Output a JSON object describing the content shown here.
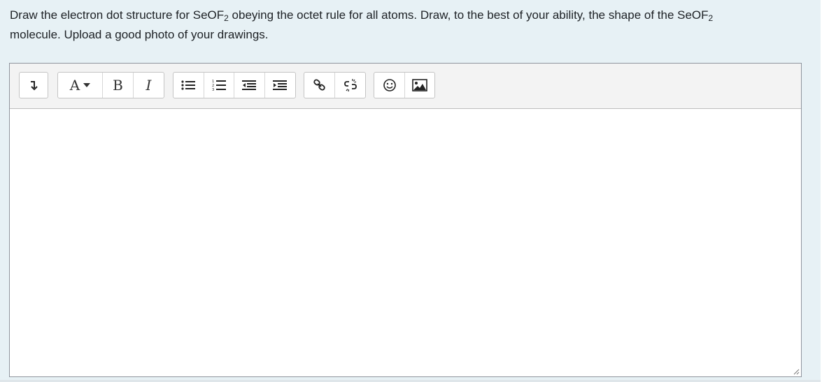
{
  "question": {
    "text_part1": "Draw the electron dot structure for SeOF",
    "sub1": "2",
    "text_part2": " obeying the octet rule for all atoms.  Draw, to the best of your ability, the shape of the SeOF",
    "sub2": "2",
    "text_part3": " molecule.  Upload a good photo of your drawings."
  },
  "toolbar": {
    "groups": [
      {
        "name": "collapse",
        "buttons": [
          {
            "icon": "collapse-arrow-icon",
            "label": ""
          }
        ]
      },
      {
        "name": "style",
        "buttons": [
          {
            "icon": "paragraph-style-icon",
            "label": "A"
          },
          {
            "icon": "bold-icon",
            "label": "B"
          },
          {
            "icon": "italic-icon",
            "label": "I"
          }
        ]
      },
      {
        "name": "lists",
        "buttons": [
          {
            "icon": "unordered-list-icon"
          },
          {
            "icon": "ordered-list-icon"
          },
          {
            "icon": "outdent-icon"
          },
          {
            "icon": "indent-icon"
          }
        ]
      },
      {
        "name": "links",
        "buttons": [
          {
            "icon": "link-icon"
          },
          {
            "icon": "unlink-icon"
          }
        ]
      },
      {
        "name": "media",
        "buttons": [
          {
            "icon": "emoticon-icon"
          },
          {
            "icon": "image-icon"
          }
        ]
      }
    ]
  },
  "editor": {
    "content": ""
  }
}
